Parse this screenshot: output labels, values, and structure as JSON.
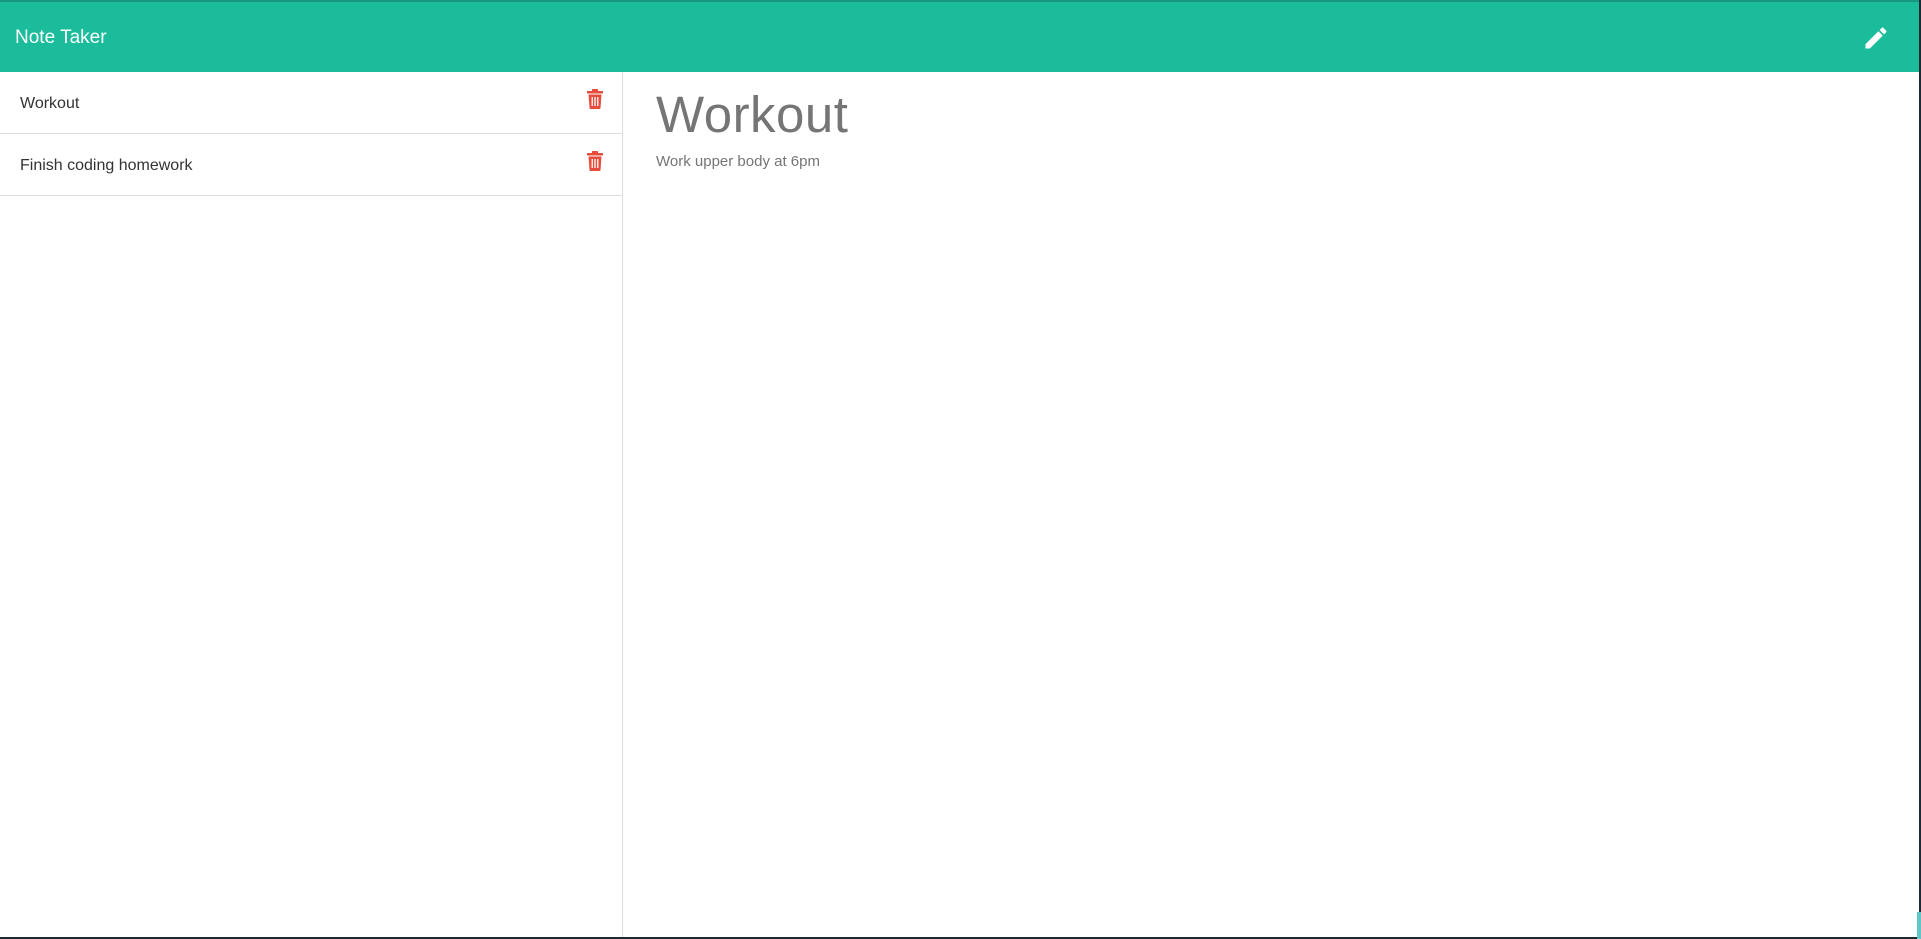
{
  "navbar": {
    "title": "Note Taker",
    "new_note_icon": "pencil-icon",
    "background_color": "#1abc9c"
  },
  "sidebar": {
    "notes": [
      {
        "title": "Workout",
        "delete_icon": "trash-icon"
      },
      {
        "title": "Finish coding homework",
        "delete_icon": "trash-icon"
      }
    ],
    "delete_color": "#e74c3c"
  },
  "active_note": {
    "title": "Workout",
    "text": "Work upper body at 6pm"
  }
}
